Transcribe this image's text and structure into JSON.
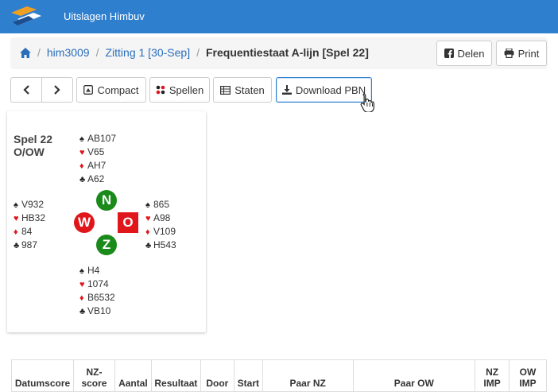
{
  "header": {
    "app_title": "Uitslagen Himbuv"
  },
  "breadcrumb": [
    {
      "label": "him3009"
    },
    {
      "label": "Zitting 1 [30-Sep]"
    },
    {
      "label": "Frequentiestaat A-lijn [Spel 22]"
    }
  ],
  "header_buttons": {
    "share": "Delen",
    "print": "Print"
  },
  "toolbar": {
    "compact": "Compact",
    "games": "Spellen",
    "states": "Staten",
    "download": "Download PBN"
  },
  "deal": {
    "title_line1": "Spel 22",
    "title_line2": "O/OW",
    "north": [
      "AB107",
      "V65",
      "AH7",
      "A62"
    ],
    "west": [
      "V932",
      "HB32",
      "84",
      "987"
    ],
    "east": [
      "865",
      "A98",
      "V109",
      "H543"
    ],
    "south": [
      "H4",
      "1074",
      "B6532",
      "VB10"
    ],
    "compass": {
      "n": "N",
      "w": "W",
      "o": "O",
      "z": "Z"
    },
    "colors": {
      "green": "#1a8a1a",
      "red": "#e0161b"
    }
  },
  "table": {
    "headers": [
      {
        "l1": "",
        "l2": "Datumscore"
      },
      {
        "l1": "NZ-",
        "l2": "score"
      },
      {
        "l1": "",
        "l2": "Aantal"
      },
      {
        "l1": "",
        "l2": "Resultaat"
      },
      {
        "l1": "",
        "l2": "Door"
      },
      {
        "l1": "",
        "l2": "Start"
      },
      {
        "l1": "",
        "l2": "Paar NZ"
      },
      {
        "l1": "",
        "l2": "Paar OW"
      },
      {
        "l1": "NZ",
        "l2": "IMP"
      },
      {
        "l1": "OW",
        "l2": "IMP"
      }
    ]
  },
  "theme": {
    "topbar": "#2f7fcf",
    "link": "#2a6ebb"
  }
}
